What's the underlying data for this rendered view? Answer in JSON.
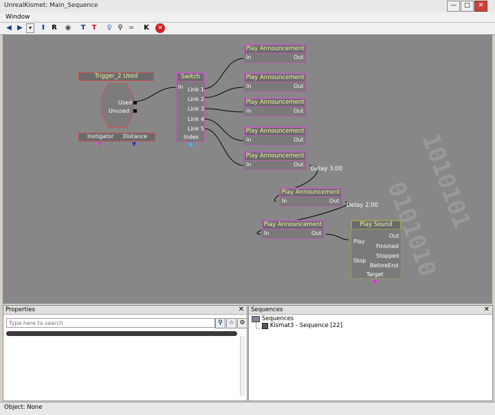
{
  "window": {
    "title": "UnrealKismet: Main_Sequence",
    "min_label": "—",
    "max_label": "□",
    "close_label": "✕"
  },
  "menu": {
    "window": "Window"
  },
  "toolbar": {
    "icons": [
      "back-icon",
      "forward-icon",
      "dropdown-icon",
      "parent-sequence-icon",
      "rename-icon",
      "eye-icon",
      "filter-t-icon",
      "filter-t-red-icon",
      "lightbulb-icon",
      "zoom-icon",
      "link-icon",
      "kismet-k-icon",
      "stop-icon"
    ]
  },
  "graph": {
    "trigger": {
      "title": "Trigger_2 Used",
      "used": "Used",
      "unused": "Unused",
      "instigator": "Instigator",
      "distance": "Distance"
    },
    "switch": {
      "title": "Switch",
      "in": "In",
      "links": [
        "Link 1",
        "Link 2",
        "Link 3",
        "Link 4",
        "Link 5"
      ],
      "index": "Index"
    },
    "announcements": [
      {
        "title": "Play Announcement",
        "in": "In",
        "out": "Out"
      },
      {
        "title": "Play Announcement",
        "in": "In",
        "out": "Out"
      },
      {
        "title": "Play Announcement",
        "in": "In",
        "out": "Out"
      },
      {
        "title": "Play Announcement",
        "in": "In",
        "out": "Out"
      },
      {
        "title": "Play Announcement",
        "in": "In",
        "out": "Out"
      },
      {
        "title": "Play Announcement",
        "in": "In",
        "out": "Out"
      },
      {
        "title": "Play Announcement",
        "in": "In",
        "out": "Out"
      }
    ],
    "delays": [
      "Delay 3.00",
      "Delay 2.00"
    ],
    "play_sound": {
      "title": "Play Sound",
      "play": "Play",
      "stop": "Stop",
      "out": "Out",
      "finished": "Finished",
      "stopped": "Stopped",
      "before_end": "BeforeEnd",
      "target": "Target"
    }
  },
  "properties": {
    "title": "Properties",
    "search_placeholder": "Type here to search"
  },
  "sequences": {
    "title": "Sequences",
    "root": "Sequences",
    "child": "Kismat3 - Sequence [22]"
  },
  "status": {
    "text": "Object: None"
  }
}
